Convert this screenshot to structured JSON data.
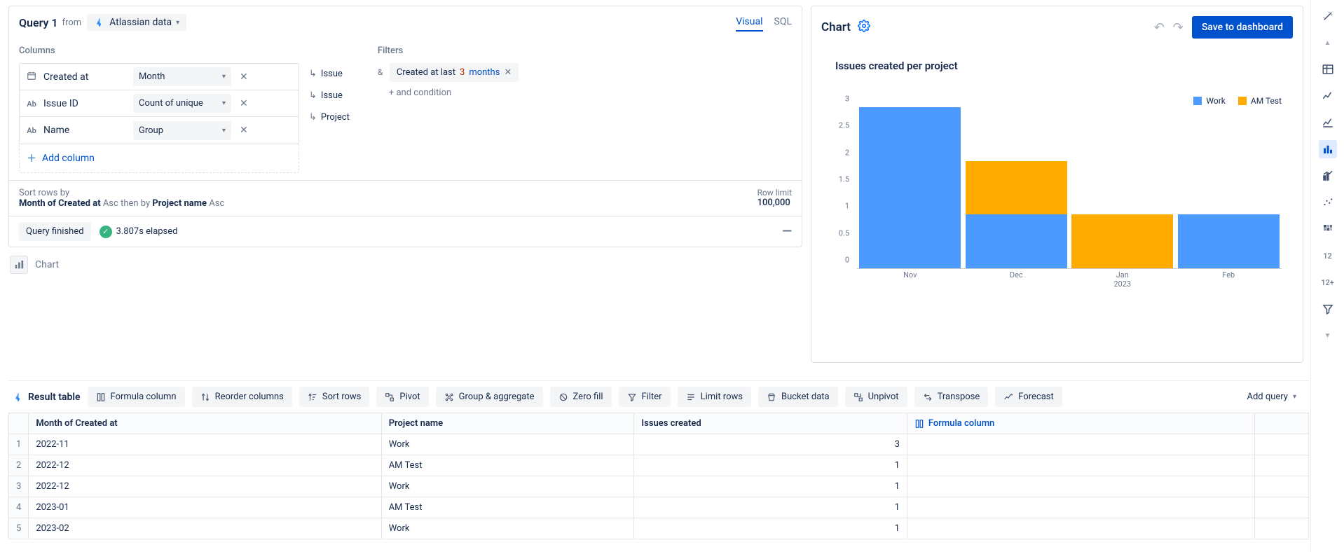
{
  "query": {
    "title": "Query 1",
    "from_label": "from",
    "source_label": "Atlassian data",
    "tabs": {
      "visual": "Visual",
      "sql": "SQL"
    }
  },
  "sections": {
    "columns_label": "Columns",
    "filters_label": "Filters"
  },
  "columns": [
    {
      "icon": "calendar",
      "name": "Created at",
      "agg": "Month",
      "src": "Issue"
    },
    {
      "icon": "Ab",
      "name": "Issue ID",
      "agg": "Count of unique",
      "src": "Issue"
    },
    {
      "icon": "Ab",
      "name": "Name",
      "agg": "Group",
      "src": "Project"
    }
  ],
  "add_column_label": "Add column",
  "filters": {
    "chip_prefix": "Created at last",
    "chip_number": "3",
    "chip_unit": "months",
    "add_condition": "+ and condition"
  },
  "sort": {
    "label": "Sort rows by",
    "field1": "Month of Created at",
    "dir1": "Asc",
    "then": "then by",
    "field2": "Project name",
    "dir2": "Asc",
    "row_limit_label": "Row limit",
    "row_limit_value": "100,000"
  },
  "status": {
    "chip": "Query finished",
    "elapsed": "3.807s elapsed"
  },
  "chart_chip_label": "Chart",
  "chart": {
    "panel_title": "Chart",
    "save_button": "Save to dashboard",
    "inner_title": "Issues created per project",
    "legend": {
      "work": "Work",
      "am": "AM Test"
    }
  },
  "chart_data": {
    "type": "bar",
    "stacked": true,
    "categories": [
      "Nov",
      "Dec",
      "Jan\n2023",
      "Feb"
    ],
    "series": [
      {
        "name": "Work",
        "color": "#4C9AFF",
        "values": [
          3,
          1,
          0,
          1
        ]
      },
      {
        "name": "AM Test",
        "color": "#FFAB00",
        "values": [
          0,
          1,
          1,
          0
        ]
      }
    ],
    "ylim": [
      0,
      3
    ],
    "ytick_step": 0.5,
    "yticks": [
      "0",
      "0.5",
      "1",
      "1.5",
      "2",
      "2.5",
      "3"
    ],
    "xlabel": "",
    "ylabel": ""
  },
  "results": {
    "title": "Result table",
    "tools": {
      "formula": "Formula column",
      "reorder": "Reorder columns",
      "sort": "Sort rows",
      "pivot": "Pivot",
      "group": "Group & aggregate",
      "zerofill": "Zero fill",
      "filter": "Filter",
      "limit": "Limit rows",
      "bucket": "Bucket data",
      "unpivot": "Unpivot",
      "transpose": "Transpose",
      "forecast": "Forecast"
    },
    "add_query": "Add query",
    "headers": [
      "Month of Created at",
      "Project name",
      "Issues created"
    ],
    "formula_column_header": "Formula column",
    "rows": [
      {
        "month": "2022-11",
        "project": "Work",
        "count": "3"
      },
      {
        "month": "2022-12",
        "project": "AM Test",
        "count": "1"
      },
      {
        "month": "2022-12",
        "project": "Work",
        "count": "1"
      },
      {
        "month": "2023-01",
        "project": "AM Test",
        "count": "1"
      },
      {
        "month": "2023-02",
        "project": "Work",
        "count": "1"
      }
    ]
  },
  "toolbox_labels": {
    "n12": "12",
    "n12p": "12+"
  }
}
